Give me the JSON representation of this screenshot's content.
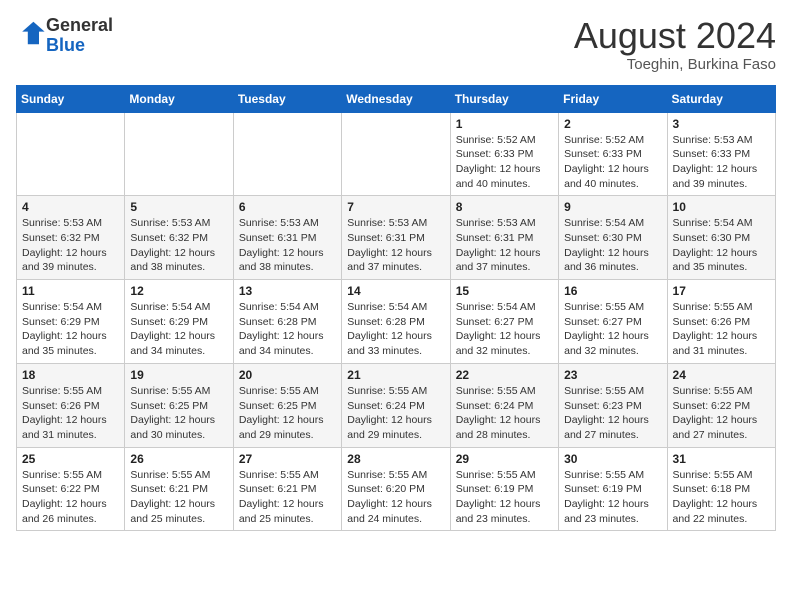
{
  "header": {
    "logo_general": "General",
    "logo_blue": "Blue",
    "month_title": "August 2024",
    "location": "Toeghin, Burkina Faso"
  },
  "days_of_week": [
    "Sunday",
    "Monday",
    "Tuesday",
    "Wednesday",
    "Thursday",
    "Friday",
    "Saturday"
  ],
  "weeks": [
    [
      {
        "day": "",
        "info": ""
      },
      {
        "day": "",
        "info": ""
      },
      {
        "day": "",
        "info": ""
      },
      {
        "day": "",
        "info": ""
      },
      {
        "day": "1",
        "info": "Sunrise: 5:52 AM\nSunset: 6:33 PM\nDaylight: 12 hours and 40 minutes."
      },
      {
        "day": "2",
        "info": "Sunrise: 5:52 AM\nSunset: 6:33 PM\nDaylight: 12 hours and 40 minutes."
      },
      {
        "day": "3",
        "info": "Sunrise: 5:53 AM\nSunset: 6:33 PM\nDaylight: 12 hours and 39 minutes."
      }
    ],
    [
      {
        "day": "4",
        "info": "Sunrise: 5:53 AM\nSunset: 6:32 PM\nDaylight: 12 hours and 39 minutes."
      },
      {
        "day": "5",
        "info": "Sunrise: 5:53 AM\nSunset: 6:32 PM\nDaylight: 12 hours and 38 minutes."
      },
      {
        "day": "6",
        "info": "Sunrise: 5:53 AM\nSunset: 6:31 PM\nDaylight: 12 hours and 38 minutes."
      },
      {
        "day": "7",
        "info": "Sunrise: 5:53 AM\nSunset: 6:31 PM\nDaylight: 12 hours and 37 minutes."
      },
      {
        "day": "8",
        "info": "Sunrise: 5:53 AM\nSunset: 6:31 PM\nDaylight: 12 hours and 37 minutes."
      },
      {
        "day": "9",
        "info": "Sunrise: 5:54 AM\nSunset: 6:30 PM\nDaylight: 12 hours and 36 minutes."
      },
      {
        "day": "10",
        "info": "Sunrise: 5:54 AM\nSunset: 6:30 PM\nDaylight: 12 hours and 35 minutes."
      }
    ],
    [
      {
        "day": "11",
        "info": "Sunrise: 5:54 AM\nSunset: 6:29 PM\nDaylight: 12 hours and 35 minutes."
      },
      {
        "day": "12",
        "info": "Sunrise: 5:54 AM\nSunset: 6:29 PM\nDaylight: 12 hours and 34 minutes."
      },
      {
        "day": "13",
        "info": "Sunrise: 5:54 AM\nSunset: 6:28 PM\nDaylight: 12 hours and 34 minutes."
      },
      {
        "day": "14",
        "info": "Sunrise: 5:54 AM\nSunset: 6:28 PM\nDaylight: 12 hours and 33 minutes."
      },
      {
        "day": "15",
        "info": "Sunrise: 5:54 AM\nSunset: 6:27 PM\nDaylight: 12 hours and 32 minutes."
      },
      {
        "day": "16",
        "info": "Sunrise: 5:55 AM\nSunset: 6:27 PM\nDaylight: 12 hours and 32 minutes."
      },
      {
        "day": "17",
        "info": "Sunrise: 5:55 AM\nSunset: 6:26 PM\nDaylight: 12 hours and 31 minutes."
      }
    ],
    [
      {
        "day": "18",
        "info": "Sunrise: 5:55 AM\nSunset: 6:26 PM\nDaylight: 12 hours and 31 minutes."
      },
      {
        "day": "19",
        "info": "Sunrise: 5:55 AM\nSunset: 6:25 PM\nDaylight: 12 hours and 30 minutes."
      },
      {
        "day": "20",
        "info": "Sunrise: 5:55 AM\nSunset: 6:25 PM\nDaylight: 12 hours and 29 minutes."
      },
      {
        "day": "21",
        "info": "Sunrise: 5:55 AM\nSunset: 6:24 PM\nDaylight: 12 hours and 29 minutes."
      },
      {
        "day": "22",
        "info": "Sunrise: 5:55 AM\nSunset: 6:24 PM\nDaylight: 12 hours and 28 minutes."
      },
      {
        "day": "23",
        "info": "Sunrise: 5:55 AM\nSunset: 6:23 PM\nDaylight: 12 hours and 27 minutes."
      },
      {
        "day": "24",
        "info": "Sunrise: 5:55 AM\nSunset: 6:22 PM\nDaylight: 12 hours and 27 minutes."
      }
    ],
    [
      {
        "day": "25",
        "info": "Sunrise: 5:55 AM\nSunset: 6:22 PM\nDaylight: 12 hours and 26 minutes."
      },
      {
        "day": "26",
        "info": "Sunrise: 5:55 AM\nSunset: 6:21 PM\nDaylight: 12 hours and 25 minutes."
      },
      {
        "day": "27",
        "info": "Sunrise: 5:55 AM\nSunset: 6:21 PM\nDaylight: 12 hours and 25 minutes."
      },
      {
        "day": "28",
        "info": "Sunrise: 5:55 AM\nSunset: 6:20 PM\nDaylight: 12 hours and 24 minutes."
      },
      {
        "day": "29",
        "info": "Sunrise: 5:55 AM\nSunset: 6:19 PM\nDaylight: 12 hours and 23 minutes."
      },
      {
        "day": "30",
        "info": "Sunrise: 5:55 AM\nSunset: 6:19 PM\nDaylight: 12 hours and 23 minutes."
      },
      {
        "day": "31",
        "info": "Sunrise: 5:55 AM\nSunset: 6:18 PM\nDaylight: 12 hours and 22 minutes."
      }
    ]
  ]
}
